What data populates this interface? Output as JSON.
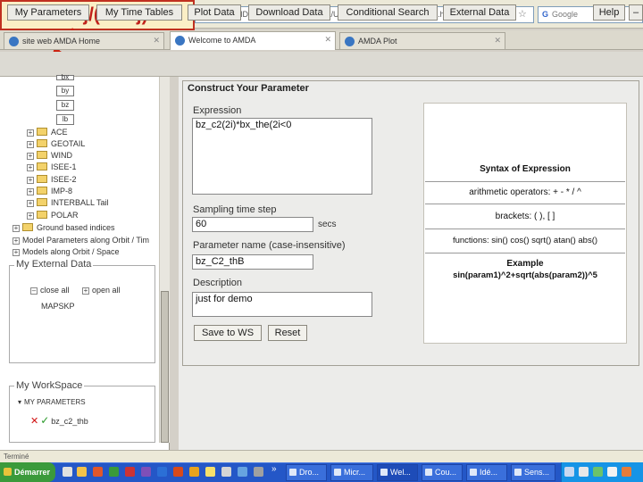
{
  "annotation": {
    "title": "Pi-Pj/(Xi-Xj)",
    "arrow_color": "#cc2211"
  },
  "browser": {
    "url": "file:///C:/AMDA_PRETEST/DDHTML/USERS/jacquey/HTML/Panel.html",
    "reload_icon": "reload-icon",
    "search_placeholder": "Google",
    "tabs": [
      {
        "label": "site web AMDA Home"
      },
      {
        "label": "Welcome to AMDA"
      },
      {
        "label": "AMDA Plot"
      }
    ]
  },
  "menu": [
    "My Parameters",
    "My Time Tables",
    "Plot Data",
    "Download Data",
    "Conditional Search",
    "External Data",
    "Help",
    "–"
  ],
  "tree": {
    "leaves": [
      "bx",
      "by",
      "bz",
      "lb"
    ],
    "folders": [
      "ACE",
      "GEOTAIL",
      "WIND",
      "ISEE-1",
      "ISEE-2",
      "IMP-8",
      "INTERBALL Tail",
      "POLAR"
    ],
    "ground": "Ground based indices",
    "models": [
      "Model Parameters along Orbit / Tim",
      "Models along Orbit / Space"
    ],
    "external_title": "My External Data",
    "collapse_label": "close all",
    "expand_label": "open all",
    "mapskp": "MAPSKP",
    "workspace_title": "My WorkSpace",
    "workspace_section": "MY PARAMETERS",
    "workspace_item": "bz_c2_thb"
  },
  "form": {
    "title": "Construct Your Parameter",
    "expression_label": "Expression",
    "expression_value": "bz_c2(2i)*bx_the(2i<0",
    "sampling_label": "Sampling time step",
    "sampling_value": "60",
    "sampling_unit": "secs",
    "name_label": "Parameter name (case-insensitive)",
    "name_value": "bz_C2_thB",
    "description_label": "Description",
    "description_value": "just for demo",
    "save_button": "Save to WS",
    "reset_button": "Reset"
  },
  "syntax": {
    "title": "Syntax of Expression",
    "operators": "arithmetic operators: + - * / ^",
    "brackets": "brackets: ( ), [ ]",
    "functions": "functions: sin() cos() sqrt() atan() abs()",
    "example_title": "Example",
    "example": "sin(param1)^2+sqrt(abs(param2))^5"
  },
  "status": "Terminé",
  "taskbar": {
    "start": "Démarrer",
    "tasks": [
      "Dro...",
      "Micr...",
      "Wel...",
      "Cou...",
      "Idé...",
      "Sens..."
    ],
    "tray_icons": [
      "shield-icon",
      "volume-icon",
      "network-icon",
      "clock-icon"
    ]
  }
}
